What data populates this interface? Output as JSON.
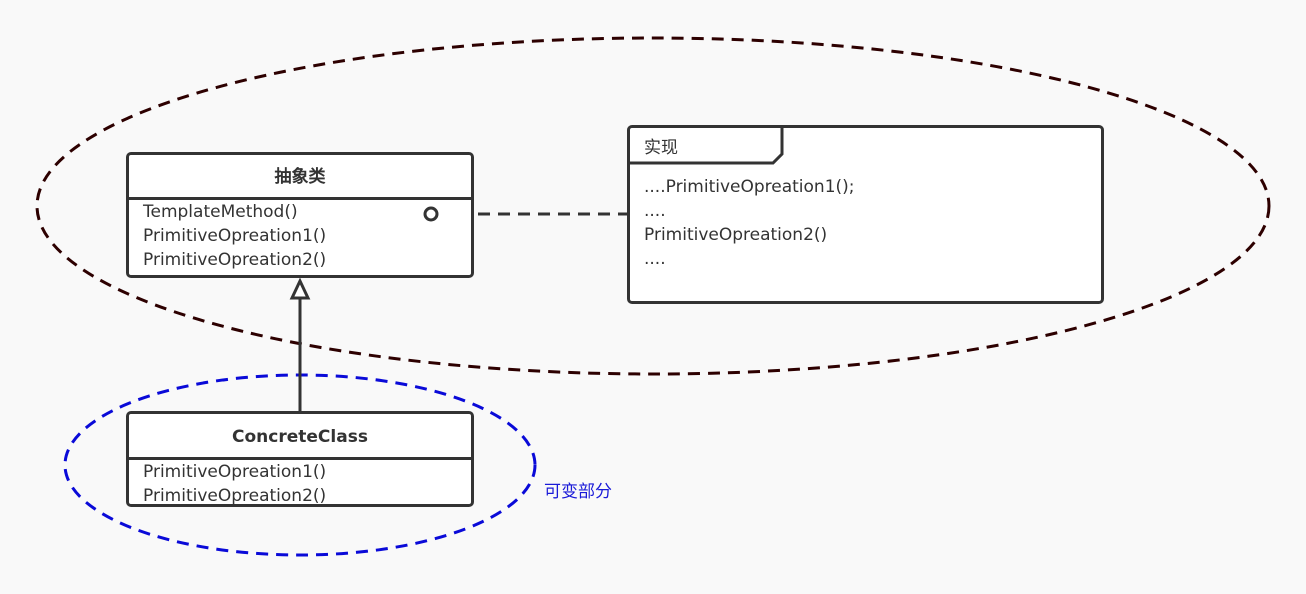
{
  "colors": {
    "stroke": "#333333",
    "invariant_ellipse": "#2d0000",
    "variable_ellipse": "#0a0ad8",
    "variable_label": "#1a1ad8",
    "box_fill": "#ffffff",
    "background": "#f9f9f9"
  },
  "abstract_class": {
    "name": "抽象类",
    "operations": [
      "TemplateMethod()",
      "PrimitiveOpreation1()",
      "PrimitiveOpreation2()"
    ]
  },
  "concrete_class": {
    "name": "ConcreteClass",
    "operations": [
      "PrimitiveOpreation1()",
      "PrimitiveOpreation2()"
    ]
  },
  "note": {
    "frame_label": "实现",
    "lines": [
      "....PrimitiveOpreation1();",
      "....",
      "PrimitiveOpreation2()",
      "...."
    ]
  },
  "variable_part_label": "可变部分"
}
